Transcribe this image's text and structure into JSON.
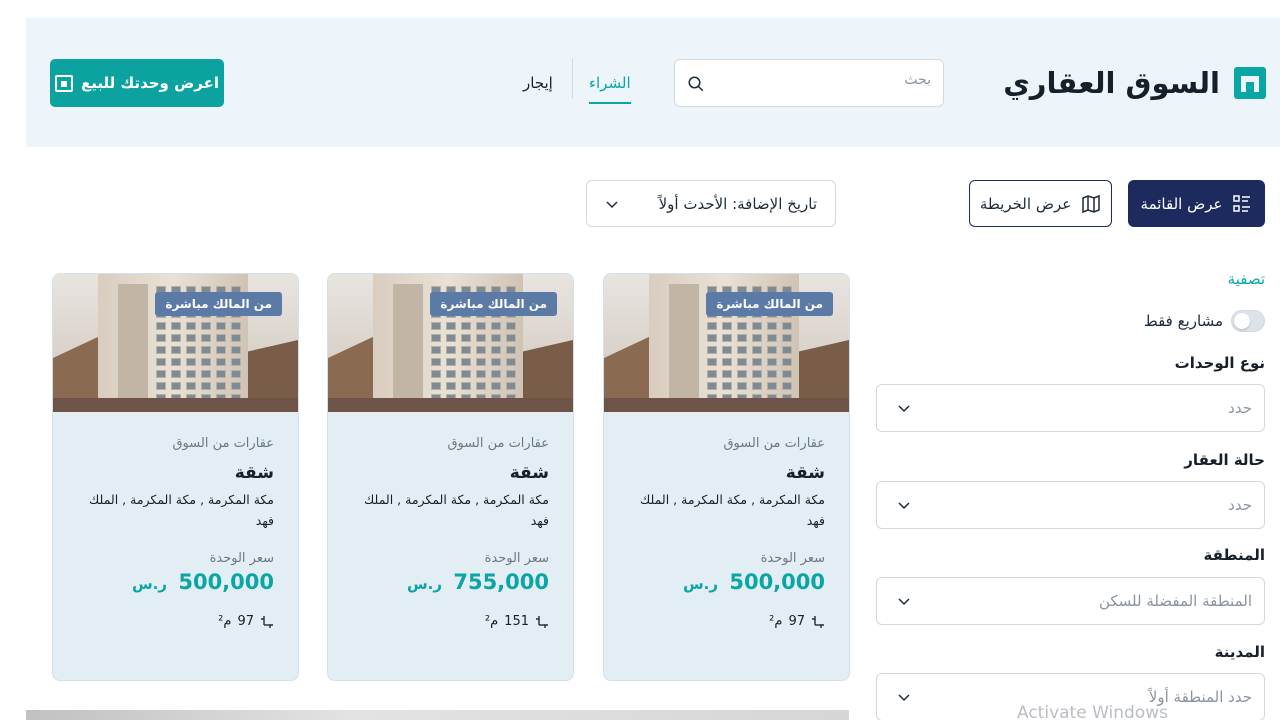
{
  "header": {
    "title": "السوق العقاري",
    "search_placeholder": "بحث",
    "tabs": [
      {
        "label": "الشراء",
        "active": true
      },
      {
        "label": "إيجار",
        "active": false
      }
    ],
    "sell_button": "اعرض وحدتك للبيع"
  },
  "toolbar": {
    "list_view": "عرض القائمة",
    "map_view": "عرض الخريطة",
    "sort_value": "تاريخ الإضافة: الأحدث أولاً"
  },
  "filters": {
    "title": "تصفية",
    "projects_only": "مشاريع فقط",
    "unit_type": {
      "label": "نوع الوحدات",
      "placeholder": "حدد"
    },
    "property_status": {
      "label": "حالة العقار",
      "placeholder": "حدد"
    },
    "region": {
      "label": "المنطقة",
      "placeholder": "المنطقة المفضلة للسكن"
    },
    "city": {
      "label": "المدينة",
      "placeholder": "حدد المنطقة أولاً"
    }
  },
  "listings": [
    {
      "badge": "من المالك مباشرة",
      "source": "عقارات من السوق",
      "type": "شقة",
      "location": "مكة المكرمة , مكة المكرمة , الملك فهد",
      "price_label": "سعر الوحدة",
      "price": "500,000",
      "currency": "ر.س",
      "area": "97",
      "area_unit": "م²"
    },
    {
      "badge": "من المالك مباشرة",
      "source": "عقارات من السوق",
      "type": "شقة",
      "location": "مكة المكرمة , مكة المكرمة , الملك فهد",
      "price_label": "سعر الوحدة",
      "price": "755,000",
      "currency": "ر.س",
      "area": "151",
      "area_unit": "م²"
    },
    {
      "badge": "من المالك مباشرة",
      "source": "عقارات من السوق",
      "type": "شقة",
      "location": "مكة المكرمة , مكة المكرمة , الملك فهد",
      "price_label": "سعر الوحدة",
      "price": "500,000",
      "currency": "ر.س",
      "area": "97",
      "area_unit": "م²"
    }
  ],
  "watermark": "Activate Windows",
  "colors": {
    "accent": "#0aa6a6",
    "primary_dark": "#1c2a5e",
    "header_bg": "#eef5fa",
    "card_bg": "#e2edf4",
    "badge_bg": "#5c7aa6"
  }
}
